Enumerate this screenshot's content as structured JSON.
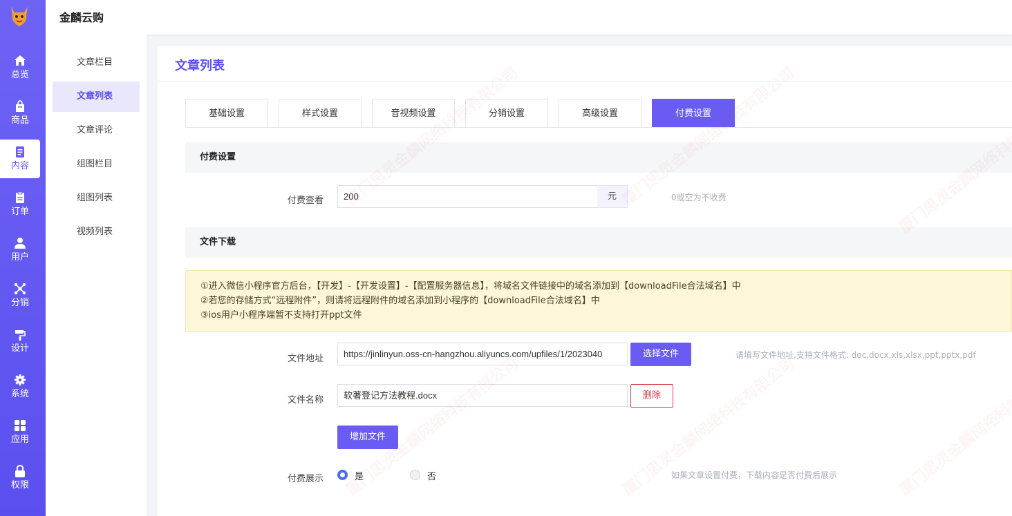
{
  "app": {
    "title": "金麟云购"
  },
  "rail": [
    {
      "label": "总览",
      "icon": "home-icon"
    },
    {
      "label": "商品",
      "icon": "bag-icon"
    },
    {
      "label": "内容",
      "icon": "document-icon",
      "active": true
    },
    {
      "label": "订单",
      "icon": "clipboard-icon"
    },
    {
      "label": "用户",
      "icon": "user-icon"
    },
    {
      "label": "分销",
      "icon": "network-icon"
    },
    {
      "label": "设计",
      "icon": "brush-icon"
    },
    {
      "label": "系统",
      "icon": "gear-icon"
    },
    {
      "label": "应用",
      "icon": "grid-icon"
    },
    {
      "label": "权限",
      "icon": "lock-icon"
    }
  ],
  "subnav": [
    {
      "label": "文章栏目"
    },
    {
      "label": "文章列表",
      "active": true
    },
    {
      "label": "文章评论"
    },
    {
      "label": "组图栏目"
    },
    {
      "label": "组图列表"
    },
    {
      "label": "视频列表"
    }
  ],
  "panel": {
    "title": "文章列表"
  },
  "tabs": [
    {
      "label": "基础设置"
    },
    {
      "label": "样式设置"
    },
    {
      "label": "音视频设置"
    },
    {
      "label": "分销设置"
    },
    {
      "label": "高级设置"
    },
    {
      "label": "付费设置",
      "active": true
    }
  ],
  "paid": {
    "section_title": "付费设置",
    "view_label": "付费查看",
    "view_value": "200",
    "view_unit": "元",
    "view_hint": "0或空为不收费"
  },
  "download": {
    "section_title": "文件下载",
    "notice": [
      "①进入微信小程序官方后台，【开发】-【开发设置】-【配置服务器信息】，将域名文件链接中的域名添加到【downloadFile合法域名】中",
      "②若您的存储方式“远程附件”，则请将远程附件的域名添加到小程序的【downloadFile合法域名】中",
      "③ios用户小程序端暂不支持打开ppt文件"
    ],
    "file_url_label": "文件地址",
    "file_url_value": "https://jinlinyun.oss-cn-hangzhou.aliyuncs.com/upfiles/1/2023040",
    "choose_file_button": "选择文件",
    "file_url_hint": "请填写文件地址,支持文件格式: doc,docx,xls,xlsx,ppt,pptx,pdf",
    "file_name_label": "文件名称",
    "file_name_value": "软著登记方法教程.docx",
    "delete_button": "删除",
    "add_file_button": "增加文件",
    "show_label": "付费展示",
    "show_options": [
      {
        "label": "是",
        "checked": true
      },
      {
        "label": "否",
        "checked": false
      }
    ],
    "show_hint": "如果文章设置付费，下载内容是否付费后展示"
  },
  "watermark": "厦门思灵金麟网络科技有限公司",
  "colors": {
    "accent": "#6a5cf3",
    "danger": "#d23b4b",
    "notice_bg": "#fdf6d9"
  }
}
